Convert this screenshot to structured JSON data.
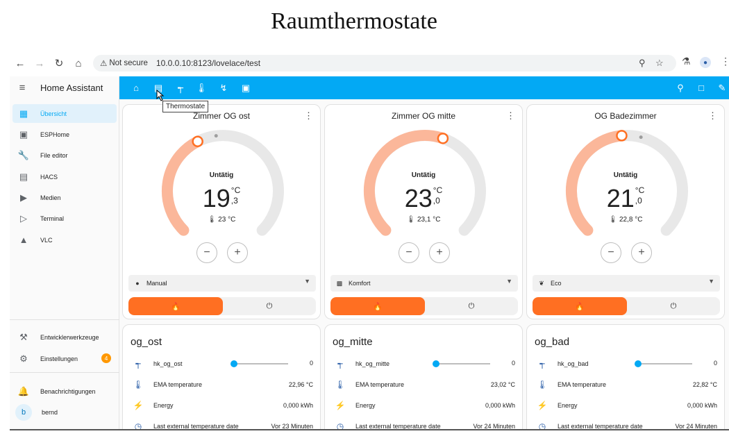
{
  "page_title": "Raumthermostate",
  "browser": {
    "not_secure": "Not secure",
    "url": "10.0.0.10:8123/lovelace/test"
  },
  "sidebar": {
    "title": "Home Assistant",
    "items": [
      {
        "label": "Übersicht",
        "icon": "dashboard-icon"
      },
      {
        "label": "ESPHome",
        "icon": "esphome-icon"
      },
      {
        "label": "File editor",
        "icon": "wrench-icon"
      },
      {
        "label": "HACS",
        "icon": "hacs-icon"
      },
      {
        "label": "Medien",
        "icon": "media-icon"
      },
      {
        "label": "Terminal",
        "icon": "terminal-icon"
      },
      {
        "label": "VLC",
        "icon": "vlc-icon"
      }
    ],
    "dev_tools": "Entwicklerwerkzeuge",
    "settings": "Einstellungen",
    "settings_badge": "4",
    "notifications": "Benachrichtigungen",
    "user_initial": "b",
    "user_name": "bernd"
  },
  "tooltip": "Thermostate",
  "colors": {
    "accent": "#03a9f4",
    "heat": "#ff6f22",
    "arc_heat": "#fbb79a",
    "arc_bg": "#e8e8e8"
  },
  "thermostats": [
    {
      "name": "Zimmer OG ost",
      "state": "Untätig",
      "target_int": "19",
      "unit": "°C",
      "target_dec": ",3",
      "current": "23 °C",
      "mode": "Manual",
      "setpoint_fraction": 0.4
    },
    {
      "name": "Zimmer OG mitte",
      "state": "Untätig",
      "target_int": "23",
      "unit": "°C",
      "target_dec": ",0",
      "current": "23,1 °C",
      "mode": "Komfort",
      "setpoint_fraction": 0.57
    },
    {
      "name": "OG Badezimmer",
      "state": "Untätig",
      "target_int": "21",
      "unit": "°C",
      "target_dec": ",0",
      "current": "22,8 °C",
      "mode": "Eco",
      "setpoint_fraction": 0.48
    }
  ],
  "entity_cards": [
    {
      "title": "og_ost",
      "rows": [
        {
          "label": "hk_og_ost",
          "value": "0"
        },
        {
          "label": "EMA temperature",
          "value": "22,96 °C"
        },
        {
          "label": "Energy",
          "value": "0,000 kWh"
        },
        {
          "label": "Last external temperature date",
          "value": "Vor 23 Minuten"
        }
      ]
    },
    {
      "title": "og_mitte",
      "rows": [
        {
          "label": "hk_og_mitte",
          "value": "0"
        },
        {
          "label": "EMA temperature",
          "value": "23,02 °C"
        },
        {
          "label": "Energy",
          "value": "0,000 kWh"
        },
        {
          "label": "Last external temperature date",
          "value": "Vor 24 Minuten"
        }
      ]
    },
    {
      "title": "og_bad",
      "rows": [
        {
          "label": "hk_og_bad",
          "value": "0"
        },
        {
          "label": "EMA temperature",
          "value": "22,82 °C"
        },
        {
          "label": "Energy",
          "value": "0,000 kWh"
        },
        {
          "label": "Last external temperature date",
          "value": "Vor 24 Minuten"
        }
      ]
    }
  ]
}
